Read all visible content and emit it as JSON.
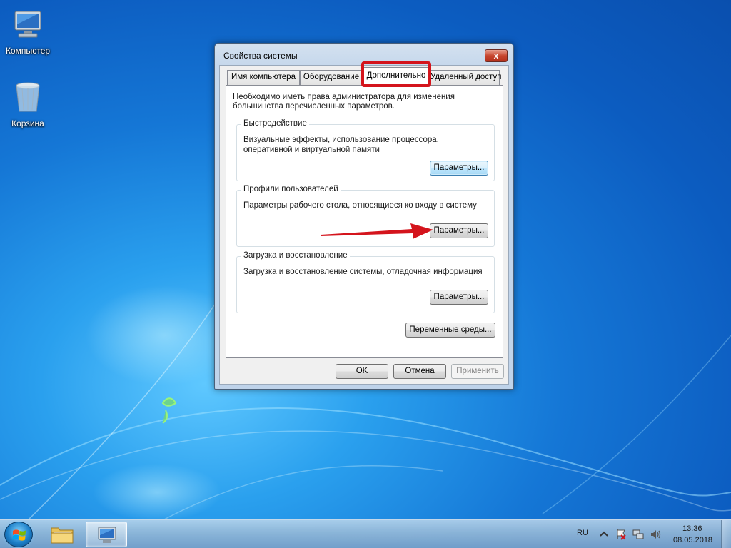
{
  "desktop": {
    "icons": [
      {
        "label": "Компьютер"
      },
      {
        "label": "Корзина"
      }
    ]
  },
  "window": {
    "title": "Свойства системы",
    "close_label": "x",
    "tabs": [
      {
        "label": "Имя компьютера",
        "active": false
      },
      {
        "label": "Оборудование",
        "active": false
      },
      {
        "label": "Дополнительно",
        "active": true
      },
      {
        "label": "Удаленный доступ",
        "active": false
      }
    ],
    "admin_note": "Необходимо иметь права администратора для изменения большинства перечисленных параметров.",
    "groups": {
      "performance": {
        "title": "Быстродействие",
        "description": "Визуальные эффекты, использование процессора, оперативной и виртуальной памяти",
        "button": "Параметры..."
      },
      "user_profiles": {
        "title": "Профили пользователей",
        "description": "Параметры рабочего стола, относящиеся ко входу в систему",
        "button": "Параметры..."
      },
      "startup_recovery": {
        "title": "Загрузка и восстановление",
        "description": "Загрузка и восстановление системы, отладочная информация",
        "button": "Параметры..."
      }
    },
    "env_vars_button": "Переменные среды...",
    "footer": {
      "ok": "OK",
      "cancel": "Отмена",
      "apply": "Применить"
    }
  },
  "taskbar": {
    "language": "RU",
    "time": "13:36",
    "date": "08.05.2018"
  },
  "colors": {
    "highlight": "#d4141c",
    "focus_button": "#3c7fb1"
  }
}
